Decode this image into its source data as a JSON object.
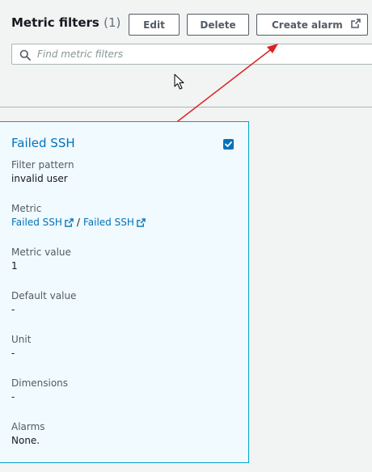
{
  "header": {
    "title": "Metric filters",
    "count": "(1)",
    "edit_label": "Edit",
    "delete_label": "Delete",
    "create_alarm_label": "Create alarm"
  },
  "search": {
    "placeholder": "Find metric filters",
    "value": ""
  },
  "card": {
    "title": "Failed SSH",
    "selected": true,
    "filter_pattern_label": "Filter pattern",
    "filter_pattern_value": "invalid user",
    "metric_label": "Metric",
    "metric_namespace": "Failed SSH",
    "metric_separator": "/",
    "metric_name": "Failed SSH",
    "metric_value_label": "Metric value",
    "metric_value": "1",
    "default_value_label": "Default value",
    "default_value": "-",
    "unit_label": "Unit",
    "unit_value": "-",
    "dimensions_label": "Dimensions",
    "dimensions_value": "-",
    "alarms_label": "Alarms",
    "alarms_value": "None."
  },
  "colors": {
    "accent": "#0073bb",
    "card_background": "#f1faff",
    "card_border": "#00a1c9",
    "annotation_arrow": "#e02020"
  },
  "icons": {
    "search": "search-icon",
    "external_link": "external-link-icon",
    "checkbox": "checkbox-checked-icon",
    "cursor": "mouse-pointer-icon"
  }
}
